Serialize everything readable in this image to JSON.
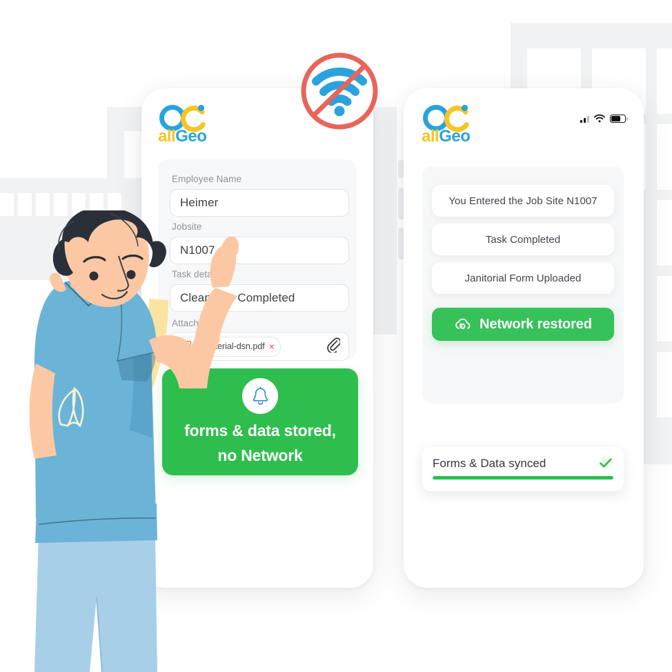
{
  "scene": {
    "title": "allGeo offline forms and data sync illustration",
    "colors": {
      "brand_blue": "#2aa3dd",
      "brand_yellow": "#f5c524",
      "success_green": "#2ebe4e",
      "banner_green": "#37c15a",
      "alert_red": "#e8655a",
      "panel_gray": "#f7f8f9",
      "building_gray": "#f1f2f3",
      "text_dark": "#41454b",
      "text_muted": "#8d9299"
    }
  },
  "no_network_badge": {
    "icon": "no-wifi-icon",
    "meaning": "no network connection"
  },
  "phone_left": {
    "logo": {
      "icon": "allgeo-logo-icon",
      "text_all": "all",
      "text_geo": "Geo"
    },
    "form": {
      "fields": [
        {
          "label": "Employee Name",
          "value": "Heimer",
          "name": "employee-name"
        },
        {
          "label": "Jobsite",
          "value": "N1007",
          "name": "jobsite"
        },
        {
          "label": "Task details",
          "value": "Cleaning - Completed",
          "name": "task-details"
        }
      ],
      "attachment": {
        "label": "Attachment",
        "file_name": "n-material-dsn.pdf",
        "remove_label": "×",
        "clip_icon": "paperclip-icon",
        "file_icon": "pdf-file-icon"
      }
    },
    "banner": {
      "icon": "bell-icon",
      "line1": "forms & data stored,",
      "line2": "no Network"
    }
  },
  "phone_right": {
    "logo": {
      "icon": "allgeo-logo-icon",
      "text_all": "all",
      "text_geo": "Geo"
    },
    "status_bar": {
      "signal_icon": "cellular-signal-icon",
      "wifi_icon": "wifi-icon",
      "battery_icon": "battery-icon"
    },
    "notifications": [
      {
        "text": "You Entered the Job Site N1007",
        "style": "plain"
      },
      {
        "text": "Task Completed",
        "style": "plain"
      },
      {
        "text": "Janitorial Form Uploaded",
        "style": "plain"
      },
      {
        "text": "Network restored",
        "style": "green",
        "icon": "cloud-sync-icon"
      }
    ],
    "sync": {
      "label": "Forms & Data synced",
      "status_icon": "check-icon",
      "progress_percent": 100
    }
  }
}
